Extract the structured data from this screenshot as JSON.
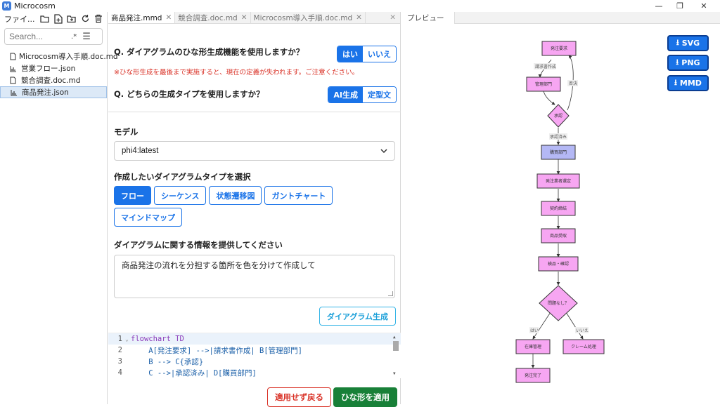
{
  "window": {
    "app_title": "Microcosm",
    "minimize": "—",
    "maximize": "❐",
    "close": "✕"
  },
  "sidebar": {
    "title": "ファイ...",
    "search_placeholder": "Search...",
    "regex_label": "*",
    "files": [
      {
        "name": "Microcosm導入手順.doc.md",
        "icon": "document-icon"
      },
      {
        "name": "営業フロー.json",
        "icon": "chart-icon"
      },
      {
        "name": "競合調査.doc.md",
        "icon": "document-icon"
      },
      {
        "name": "商品発注.json",
        "icon": "chart-icon",
        "active": true
      }
    ]
  },
  "tabs": [
    {
      "label": "商品発注.mmd",
      "active": true
    },
    {
      "label": "競合調査.doc.md"
    },
    {
      "label": "Microcosm導入手順.doc.md"
    }
  ],
  "form": {
    "q1": {
      "text": "Q. ダイアグラムのひな形生成機能を使用しますか？",
      "yes": "はい",
      "no": "いいえ"
    },
    "warning": "※ひな形生成を最後まで実施すると、現在の定義が失われます。ご注意ください。",
    "q2": {
      "text": "Q. どちらの生成タイプを使用しますか？",
      "ai": "AI生成",
      "template": "定型文"
    },
    "model_label": "モデル",
    "model_value": "phi4:latest",
    "type_label": "作成したいダイアグラムタイプを選択",
    "types": [
      "フロー",
      "シーケンス",
      "状態遷移図",
      "ガントチャート",
      "マインドマップ"
    ],
    "info_label": "ダイアグラムに関する情報を提供してください",
    "info_value": "商品発注の流れを分担する箇所を色を分けて作成して",
    "generate_button": "ダイアグラム生成",
    "code_lines": [
      {
        "n": "1",
        "text": "flowchart TD"
      },
      {
        "n": "2",
        "text": "    A[発注要求] -->|請求書作成| B[管理部門]"
      },
      {
        "n": "3",
        "text": "    B --> C{承認}"
      },
      {
        "n": "4",
        "text": "    C -->|承認済み| D[購買部門]"
      }
    ],
    "cancel_button": "適用せず戻る",
    "apply_button": "ひな形を適用"
  },
  "preview": {
    "tab": "プレビュー",
    "export": [
      "SVG",
      "PNG",
      "MMD"
    ],
    "nodes": {
      "A": "発注要求",
      "B": "管理部門",
      "C": "承認",
      "D": "購買部門",
      "E": "発注業者選定",
      "F": "契約締結",
      "G": "商品受取",
      "H": "検品・確認",
      "I": "問題なし？",
      "J": "在庫管理",
      "K": "クレーム処理",
      "L": "発注完了"
    },
    "edges": {
      "AB": "請求書作成",
      "CA": "否決",
      "CD": "承認済み",
      "IJ": "はい",
      "IK": "いいえ"
    }
  },
  "colors": {
    "accent": "#1a73e8",
    "apply": "#188038",
    "cancel": "#d93025",
    "node_pink": "#f7a6f2",
    "node_blue": "#b4b8f5"
  }
}
